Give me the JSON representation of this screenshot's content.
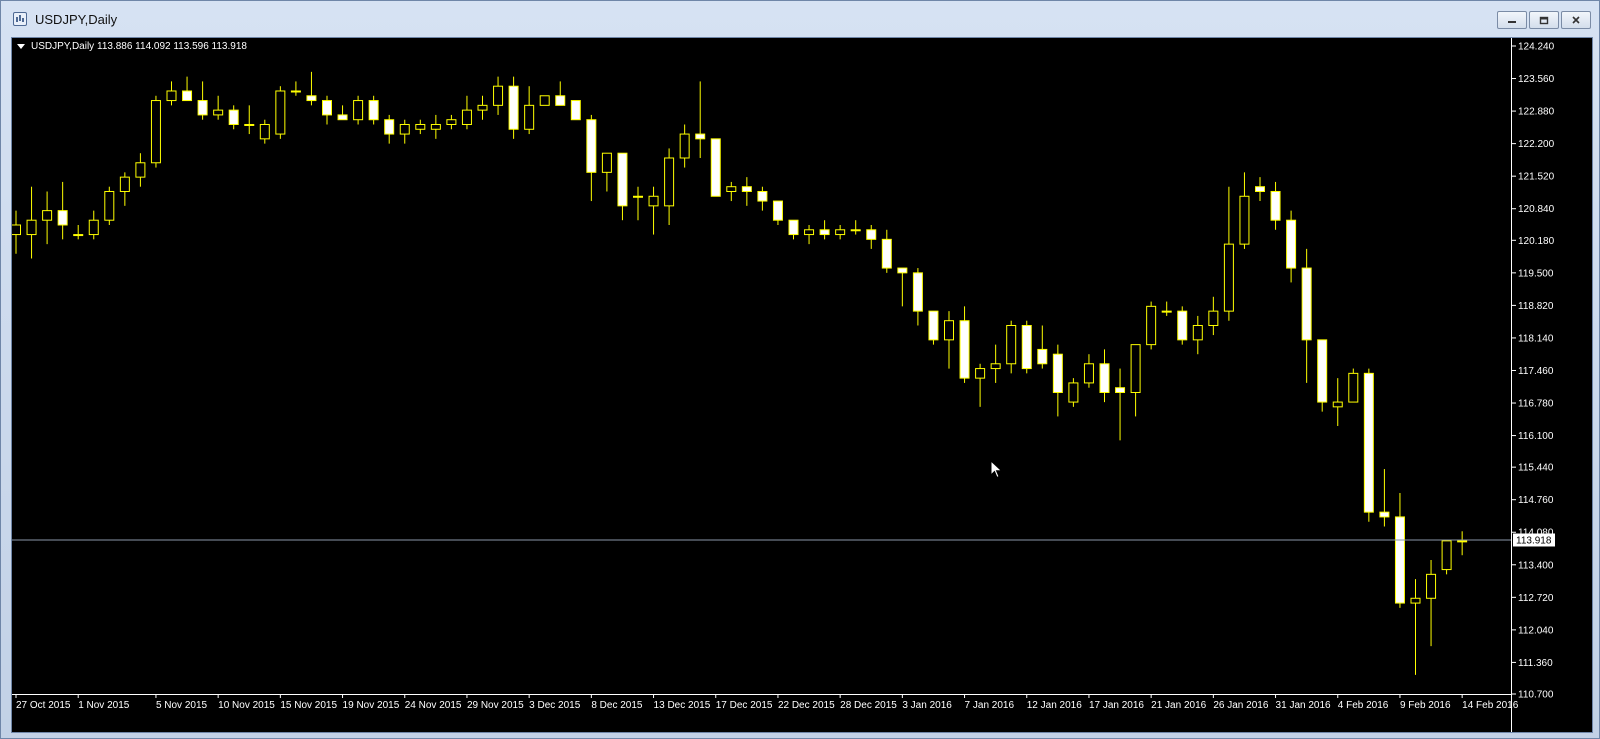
{
  "window": {
    "title": "USDJPY,Daily",
    "icons": [
      "chart-window-icon",
      "minimize-icon",
      "restore-icon",
      "close-icon"
    ]
  },
  "chart_data": {
    "type": "candlestick",
    "header_label": "USDJPY,Daily",
    "ohlc_label": "113.886 114.092 113.596 113.918",
    "current_price_label": "113.918",
    "current_price": 113.918,
    "ylim": [
      110.7,
      124.24
    ],
    "y_ticks": [
      "124.240",
      "123.560",
      "122.880",
      "122.200",
      "121.520",
      "120.840",
      "120.180",
      "119.500",
      "118.820",
      "118.140",
      "117.460",
      "116.780",
      "116.100",
      "115.440",
      "114.760",
      "114.080",
      "113.400",
      "112.720",
      "112.040",
      "111.360",
      "110.700"
    ],
    "x_labels": [
      "27 Oct 2015",
      "1 Nov 2015",
      "5 Nov 2015",
      "10 Nov 2015",
      "15 Nov 2015",
      "19 Nov 2015",
      "24 Nov 2015",
      "29 Nov 2015",
      "3 Dec 2015",
      "8 Dec 2015",
      "13 Dec 2015",
      "17 Dec 2015",
      "22 Dec 2015",
      "28 Dec 2015",
      "3 Jan 2016",
      "7 Jan 2016",
      "12 Jan 2016",
      "17 Jan 2016",
      "21 Jan 2016",
      "26 Jan 2016",
      "31 Jan 2016",
      "4 Feb 2016",
      "9 Feb 2016",
      "14 Feb 2016"
    ],
    "x_label_bars": [
      0,
      4,
      9,
      13,
      17,
      21,
      25,
      29,
      33,
      37,
      41,
      45,
      49,
      53,
      57,
      61,
      65,
      69,
      73,
      77,
      81,
      85,
      89,
      93
    ],
    "grid": false,
    "colors": {
      "background": "#000000",
      "candle": "#ffff00",
      "bull_fill": "#000000",
      "bear_fill": "#ffffff",
      "axis_text": "#ffffff",
      "price_line": "#8a96a8"
    },
    "candles": [
      {
        "o": 120.3,
        "h": 120.8,
        "l": 119.9,
        "c": 120.5
      },
      {
        "o": 120.3,
        "h": 121.3,
        "l": 119.8,
        "c": 120.6
      },
      {
        "o": 120.6,
        "h": 121.2,
        "l": 120.1,
        "c": 120.8
      },
      {
        "o": 120.8,
        "h": 121.4,
        "l": 120.2,
        "c": 120.5
      },
      {
        "o": 120.3,
        "h": 120.5,
        "l": 120.2,
        "c": 120.3
      },
      {
        "o": 120.3,
        "h": 120.8,
        "l": 120.2,
        "c": 120.6
      },
      {
        "o": 120.6,
        "h": 121.3,
        "l": 120.5,
        "c": 121.2
      },
      {
        "o": 121.2,
        "h": 121.6,
        "l": 120.9,
        "c": 121.5
      },
      {
        "o": 121.5,
        "h": 122.0,
        "l": 121.3,
        "c": 121.8
      },
      {
        "o": 121.8,
        "h": 123.2,
        "l": 121.7,
        "c": 123.1
      },
      {
        "o": 123.1,
        "h": 123.5,
        "l": 123.0,
        "c": 123.3
      },
      {
        "o": 123.3,
        "h": 123.6,
        "l": 123.1,
        "c": 123.1
      },
      {
        "o": 123.1,
        "h": 123.5,
        "l": 122.7,
        "c": 122.8
      },
      {
        "o": 122.8,
        "h": 123.2,
        "l": 122.7,
        "c": 122.9
      },
      {
        "o": 122.9,
        "h": 123.0,
        "l": 122.5,
        "c": 122.6
      },
      {
        "o": 122.6,
        "h": 123.0,
        "l": 122.4,
        "c": 122.6
      },
      {
        "o": 122.3,
        "h": 122.7,
        "l": 122.2,
        "c": 122.6
      },
      {
        "o": 122.4,
        "h": 123.4,
        "l": 122.3,
        "c": 123.3
      },
      {
        "o": 123.3,
        "h": 123.5,
        "l": 123.2,
        "c": 123.3
      },
      {
        "o": 123.2,
        "h": 123.7,
        "l": 123.0,
        "c": 123.1
      },
      {
        "o": 123.1,
        "h": 123.2,
        "l": 122.6,
        "c": 122.8
      },
      {
        "o": 122.8,
        "h": 123.0,
        "l": 122.7,
        "c": 122.7
      },
      {
        "o": 122.7,
        "h": 123.2,
        "l": 122.6,
        "c": 123.1
      },
      {
        "o": 123.1,
        "h": 123.2,
        "l": 122.6,
        "c": 122.7
      },
      {
        "o": 122.7,
        "h": 122.8,
        "l": 122.2,
        "c": 122.4
      },
      {
        "o": 122.4,
        "h": 122.7,
        "l": 122.2,
        "c": 122.6
      },
      {
        "o": 122.5,
        "h": 122.7,
        "l": 122.4,
        "c": 122.6
      },
      {
        "o": 122.5,
        "h": 122.8,
        "l": 122.3,
        "c": 122.6
      },
      {
        "o": 122.6,
        "h": 122.8,
        "l": 122.5,
        "c": 122.7
      },
      {
        "o": 122.6,
        "h": 123.2,
        "l": 122.5,
        "c": 122.9
      },
      {
        "o": 122.9,
        "h": 123.2,
        "l": 122.7,
        "c": 123.0
      },
      {
        "o": 123.0,
        "h": 123.6,
        "l": 122.8,
        "c": 123.4
      },
      {
        "o": 123.4,
        "h": 123.6,
        "l": 122.3,
        "c": 122.5
      },
      {
        "o": 122.5,
        "h": 123.4,
        "l": 122.4,
        "c": 123.0
      },
      {
        "o": 123.0,
        "h": 123.2,
        "l": 123.0,
        "c": 123.2
      },
      {
        "o": 123.2,
        "h": 123.5,
        "l": 123.0,
        "c": 123.0
      },
      {
        "o": 123.1,
        "h": 123.1,
        "l": 122.7,
        "c": 122.7
      },
      {
        "o": 122.7,
        "h": 122.8,
        "l": 121.0,
        "c": 121.6
      },
      {
        "o": 121.6,
        "h": 122.0,
        "l": 121.2,
        "c": 122.0
      },
      {
        "o": 122.0,
        "h": 122.0,
        "l": 120.6,
        "c": 120.9
      },
      {
        "o": 121.1,
        "h": 121.3,
        "l": 120.6,
        "c": 121.1
      },
      {
        "o": 120.9,
        "h": 121.3,
        "l": 120.3,
        "c": 121.1
      },
      {
        "o": 120.9,
        "h": 122.1,
        "l": 120.5,
        "c": 121.9
      },
      {
        "o": 121.9,
        "h": 122.6,
        "l": 121.7,
        "c": 122.4
      },
      {
        "o": 122.4,
        "h": 123.5,
        "l": 121.9,
        "c": 122.3
      },
      {
        "o": 122.3,
        "h": 122.3,
        "l": 121.1,
        "c": 121.1
      },
      {
        "o": 121.2,
        "h": 121.4,
        "l": 121.0,
        "c": 121.3
      },
      {
        "o": 121.3,
        "h": 121.5,
        "l": 120.9,
        "c": 121.2
      },
      {
        "o": 121.2,
        "h": 121.3,
        "l": 120.8,
        "c": 121.0
      },
      {
        "o": 121.0,
        "h": 121.0,
        "l": 120.5,
        "c": 120.6
      },
      {
        "o": 120.6,
        "h": 120.6,
        "l": 120.2,
        "c": 120.3
      },
      {
        "o": 120.3,
        "h": 120.5,
        "l": 120.1,
        "c": 120.4
      },
      {
        "o": 120.4,
        "h": 120.6,
        "l": 120.2,
        "c": 120.3
      },
      {
        "o": 120.3,
        "h": 120.5,
        "l": 120.2,
        "c": 120.4
      },
      {
        "o": 120.4,
        "h": 120.6,
        "l": 120.3,
        "c": 120.4
      },
      {
        "o": 120.4,
        "h": 120.5,
        "l": 120.0,
        "c": 120.2
      },
      {
        "o": 120.2,
        "h": 120.4,
        "l": 119.5,
        "c": 119.6
      },
      {
        "o": 119.6,
        "h": 119.6,
        "l": 118.8,
        "c": 119.5
      },
      {
        "o": 119.5,
        "h": 119.6,
        "l": 118.4,
        "c": 118.7
      },
      {
        "o": 118.7,
        "h": 118.7,
        "l": 118.0,
        "c": 118.1
      },
      {
        "o": 118.1,
        "h": 118.7,
        "l": 117.5,
        "c": 118.5
      },
      {
        "o": 118.5,
        "h": 118.8,
        "l": 117.2,
        "c": 117.3
      },
      {
        "o": 117.3,
        "h": 117.6,
        "l": 116.7,
        "c": 117.5
      },
      {
        "o": 117.5,
        "h": 118.0,
        "l": 117.2,
        "c": 117.6
      },
      {
        "o": 117.6,
        "h": 118.5,
        "l": 117.4,
        "c": 118.4
      },
      {
        "o": 118.4,
        "h": 118.5,
        "l": 117.4,
        "c": 117.5
      },
      {
        "o": 117.9,
        "h": 118.4,
        "l": 117.5,
        "c": 117.6
      },
      {
        "o": 117.8,
        "h": 118.0,
        "l": 116.5,
        "c": 117.0
      },
      {
        "o": 116.8,
        "h": 117.3,
        "l": 116.7,
        "c": 117.2
      },
      {
        "o": 117.2,
        "h": 117.8,
        "l": 117.1,
        "c": 117.6
      },
      {
        "o": 117.6,
        "h": 117.9,
        "l": 116.8,
        "c": 117.0
      },
      {
        "o": 117.1,
        "h": 117.5,
        "l": 116.0,
        "c": 117.0
      },
      {
        "o": 117.0,
        "h": 118.0,
        "l": 116.5,
        "c": 118.0
      },
      {
        "o": 118.0,
        "h": 118.9,
        "l": 117.9,
        "c": 118.8
      },
      {
        "o": 118.7,
        "h": 118.9,
        "l": 118.6,
        "c": 118.7
      },
      {
        "o": 118.7,
        "h": 118.8,
        "l": 118.0,
        "c": 118.1
      },
      {
        "o": 118.1,
        "h": 118.6,
        "l": 117.8,
        "c": 118.4
      },
      {
        "o": 118.4,
        "h": 119.0,
        "l": 118.2,
        "c": 118.7
      },
      {
        "o": 118.7,
        "h": 121.3,
        "l": 118.5,
        "c": 120.1
      },
      {
        "o": 120.1,
        "h": 121.6,
        "l": 120.0,
        "c": 121.1
      },
      {
        "o": 121.3,
        "h": 121.5,
        "l": 121.0,
        "c": 121.2
      },
      {
        "o": 121.2,
        "h": 121.4,
        "l": 120.4,
        "c": 120.6
      },
      {
        "o": 120.6,
        "h": 120.8,
        "l": 119.3,
        "c": 119.6
      },
      {
        "o": 119.6,
        "h": 120.0,
        "l": 117.2,
        "c": 118.1
      },
      {
        "o": 118.1,
        "h": 118.1,
        "l": 116.6,
        "c": 116.8
      },
      {
        "o": 116.7,
        "h": 117.3,
        "l": 116.3,
        "c": 116.8
      },
      {
        "o": 116.8,
        "h": 117.5,
        "l": 116.8,
        "c": 117.4
      },
      {
        "o": 117.4,
        "h": 117.5,
        "l": 114.3,
        "c": 114.5
      },
      {
        "o": 114.5,
        "h": 115.4,
        "l": 114.2,
        "c": 114.4
      },
      {
        "o": 114.4,
        "h": 114.9,
        "l": 112.5,
        "c": 112.6
      },
      {
        "o": 112.6,
        "h": 113.1,
        "l": 111.1,
        "c": 112.7
      },
      {
        "o": 112.7,
        "h": 113.5,
        "l": 111.7,
        "c": 113.2
      },
      {
        "o": 113.3,
        "h": 113.9,
        "l": 113.2,
        "c": 113.9
      },
      {
        "o": 113.9,
        "h": 114.1,
        "l": 113.6,
        "c": 113.9
      }
    ]
  }
}
